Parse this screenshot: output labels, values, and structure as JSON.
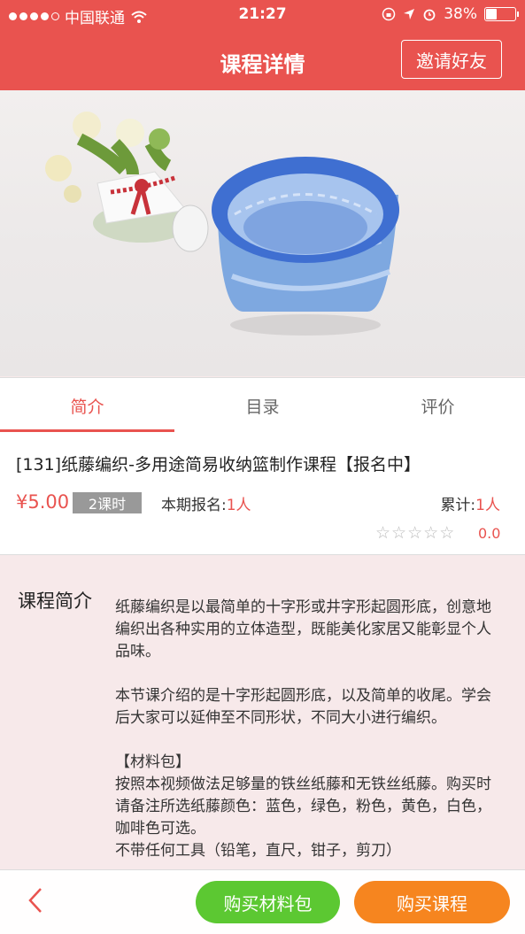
{
  "status_bar": {
    "carrier": "中国联通",
    "time": "21:27",
    "battery": "38%"
  },
  "nav": {
    "title": "课程详情",
    "invite_label": "邀请好友"
  },
  "banner": {
    "slide_count": 5,
    "active_slide": 3
  },
  "tabs": [
    {
      "label": "简介"
    },
    {
      "label": "目录"
    },
    {
      "label": "评价"
    }
  ],
  "course": {
    "title": "[131]纸藤编织-多用途简易收纳篮制作课程【报名中】",
    "price": "¥5.00",
    "lessons": "2课时",
    "enroll_label": "本期报名:",
    "enroll_count": "1人",
    "total_label": "累计:",
    "total_count": "1人",
    "rating": "0.0",
    "stars_filled": 0
  },
  "intro": {
    "label": "课程简介",
    "paragraphs": [
      "纸藤编织是以最简单的十字形或井字形起圆形底，创意地编织出各种实用的立体造型，既能美化家居又能彰显个人品味。",
      "本节课介绍的是十字形起圆形底，以及简单的收尾。学会后大家可以延伸至不同形状，不同大小进行编织。",
      "【材料包】\n按照本视频做法足够量的铁丝纸藤和无铁丝纸藤。购买时请备注所选纸藤颜色：蓝色，绿色，粉色，黄色，白色，咖啡色可选。\n不带任何工具（铅笔，直尺，钳子，剪刀）"
    ]
  },
  "bottom": {
    "buy_material_label": "购买材料包",
    "buy_course_label": "购买课程"
  },
  "colors": {
    "accent": "#e9534f",
    "green": "#5cc832",
    "orange": "#f6851f"
  }
}
